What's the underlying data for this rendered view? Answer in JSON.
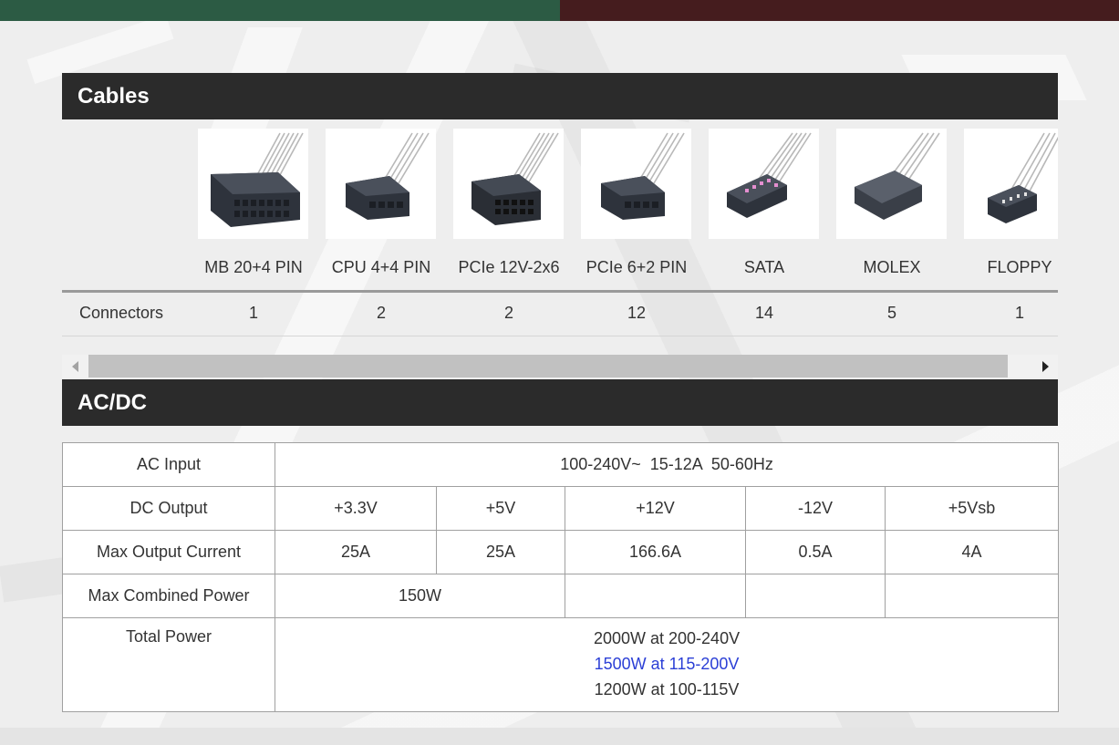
{
  "colors": {
    "top_left": "#2c5b44",
    "top_right": "#451c1e",
    "header_bg": "#2b2b2b",
    "highlight": "#2b3fd6"
  },
  "cables": {
    "title": "Cables",
    "row_label": "Connectors",
    "items": [
      {
        "name": "MB 20+4 PIN",
        "count": "1",
        "icon": "mb-24pin-connector-icon"
      },
      {
        "name": "CPU 4+4 PIN",
        "count": "2",
        "icon": "cpu-8pin-connector-icon"
      },
      {
        "name": "PCIe 12V-2x6",
        "count": "2",
        "icon": "pcie-12v-2x6-connector-icon"
      },
      {
        "name": "PCIe 6+2 PIN",
        "count": "12",
        "icon": "pcie-8pin-connector-icon"
      },
      {
        "name": "SATA",
        "count": "14",
        "icon": "sata-connector-icon"
      },
      {
        "name": "MOLEX",
        "count": "5",
        "icon": "molex-connector-icon"
      },
      {
        "name": "FLOPPY",
        "count": "1",
        "icon": "floppy-connector-icon"
      }
    ]
  },
  "acdc": {
    "title": "AC/DC",
    "ac_input": {
      "label": "AC Input",
      "value": "100-240V~  15-12A  50-60Hz"
    },
    "dc_output": {
      "label": "DC Output",
      "values": [
        "+3.3V",
        "+5V",
        "+12V",
        "-12V",
        "+5Vsb"
      ]
    },
    "max_output_current": {
      "label": "Max Output Current",
      "values": [
        "25A",
        "25A",
        "166.6A",
        "0.5A",
        "4A"
      ]
    },
    "max_combined_power": {
      "label": "Max Combined Power",
      "values": [
        "150W",
        "",
        "",
        ""
      ]
    },
    "total_power": {
      "label": "Total Power",
      "lines": [
        "2000W at 200-240V",
        "1500W at 115-200V",
        "1200W at 100-115V"
      ]
    }
  }
}
